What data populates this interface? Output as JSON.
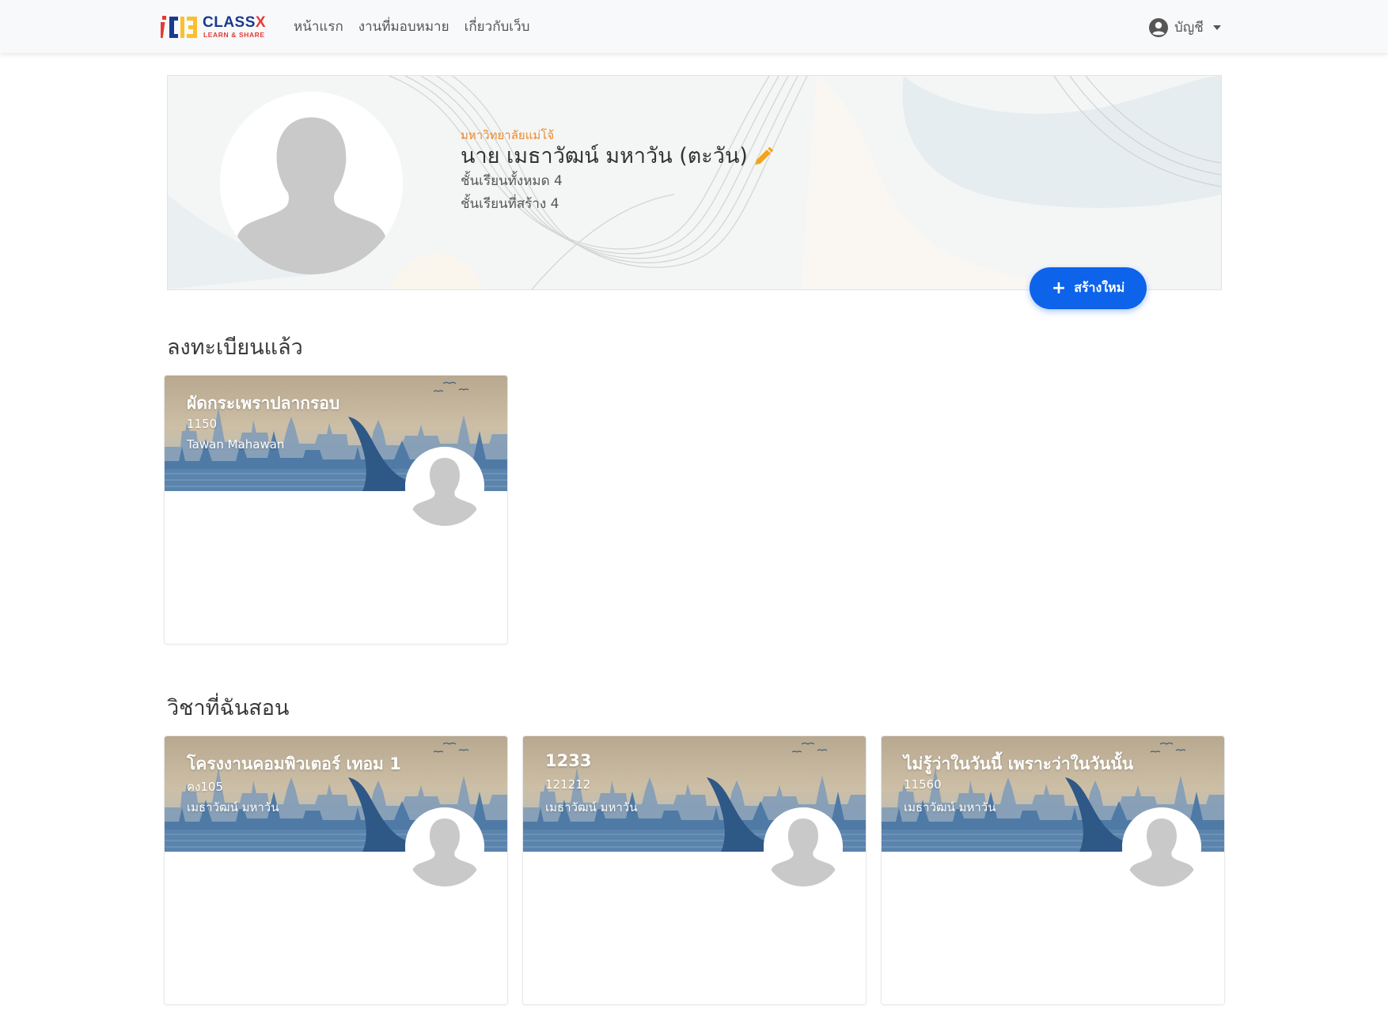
{
  "navbar": {
    "logo": {
      "mark": "iCLB",
      "name": "CLASS",
      "name_accent": "X",
      "tagline": "LEARN & SHARE"
    },
    "links": [
      {
        "label": "หน้าแรก",
        "icon": null
      },
      {
        "label": "งานที่มอบหมาย",
        "icon": null
      },
      {
        "label": "เกี่ยวกับเว็บ",
        "icon": null
      }
    ],
    "account": {
      "label": "บัญชี",
      "icon": "user-circle-icon"
    }
  },
  "profile": {
    "university": "มหาวิทยาลัยแม่โจ้",
    "name": "นาย เมธาวัฒน์ มหาวัน (ตะวัน)",
    "edit_icon": "pencil-icon",
    "total_classes": "ชั้นเรียนทั้งหมด 4",
    "created_classes": "ชั้นเรียนที่สร้าง 4"
  },
  "create_button": {
    "label": "สร้างใหม่",
    "icon": "plus-icon"
  },
  "sections": {
    "enrolled_title": "ลงทะเบียนแล้ว",
    "teaching_title": "วิชาที่ฉันสอน"
  },
  "enrolled": [
    {
      "title": "ผัดกระเพราปลากรอบ",
      "code": "1150",
      "owner": "Tawan Mahawan"
    }
  ],
  "teaching": [
    {
      "title": "โครงงานคอมพิวเตอร์ เทอม 1",
      "code": "คง105",
      "owner": "เมธาวัฒน์ มหาวัน"
    },
    {
      "title": "1233",
      "code": "121212",
      "owner": "เมธาวัฒน์ มหาวัน"
    },
    {
      "title": "ไม่รู้ว่าในวันนี้ เพราะว่าในวันนั้น",
      "code": "11560",
      "owner": "เมธาวัฒน์ มหาวัน"
    }
  ],
  "colors": {
    "primary": "#0d63ea",
    "accent_orange": "#f0892b",
    "banner_blue": "#3f6f9e",
    "banner_sky": "#c5b59a"
  }
}
